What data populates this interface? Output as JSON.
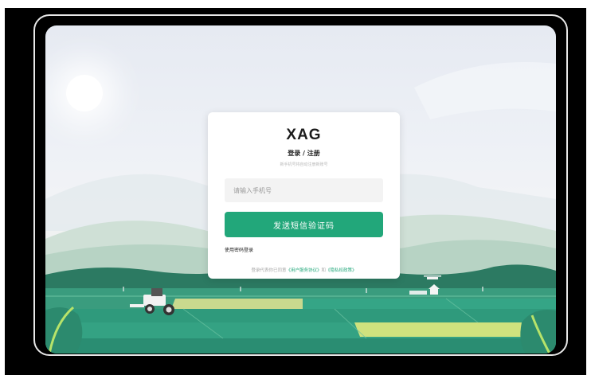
{
  "card": {
    "logo": "XAG",
    "title": "登录 / 注册",
    "subtitle": "新手机号将自动注册新账号",
    "phone_placeholder": "请输入手机号",
    "send_button": "发送短信验证码",
    "password_login": "使用密码登录",
    "agreement_prefix": "登录代表你已同意",
    "user_agreement": "《用户服务协议》",
    "agreement_and": "和",
    "privacy_policy": "《隐私权政策》"
  },
  "colors": {
    "accent": "#22a77a",
    "field_green": "#2f9a7c",
    "sky": "#e9edf3"
  },
  "icons": [
    "sun-icon",
    "tractor-icon",
    "drone-icon",
    "house-icon",
    "leaf-icon"
  ]
}
